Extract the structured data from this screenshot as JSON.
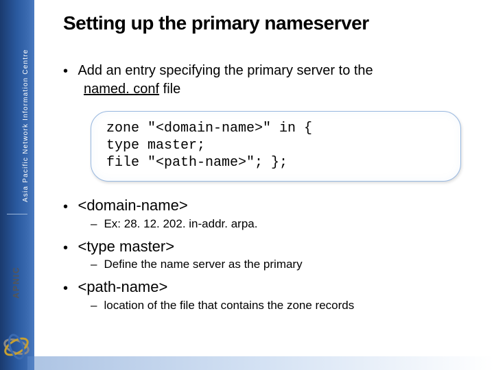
{
  "sidebar": {
    "org_name": "Asia Pacific Network Information Centre",
    "logo_text": "APNIC"
  },
  "slide": {
    "title": "Setting up the primary nameserver",
    "intro": {
      "prefix": "Add an entry specifying the primary server to the ",
      "file_u": "named. conf",
      "file_rest": " file"
    },
    "code": "zone \"<domain-name>\" in {\ntype master;\nfile \"<path-name>\"; };",
    "items": [
      {
        "term": "<domain-name>",
        "desc": "Ex: 28. 12. 202. in-addr. arpa."
      },
      {
        "term": "<type master>",
        "desc": "Define the name server as the primary"
      },
      {
        "term": "<path-name>",
        "desc": "location of the file that contains the zone records"
      }
    ]
  }
}
